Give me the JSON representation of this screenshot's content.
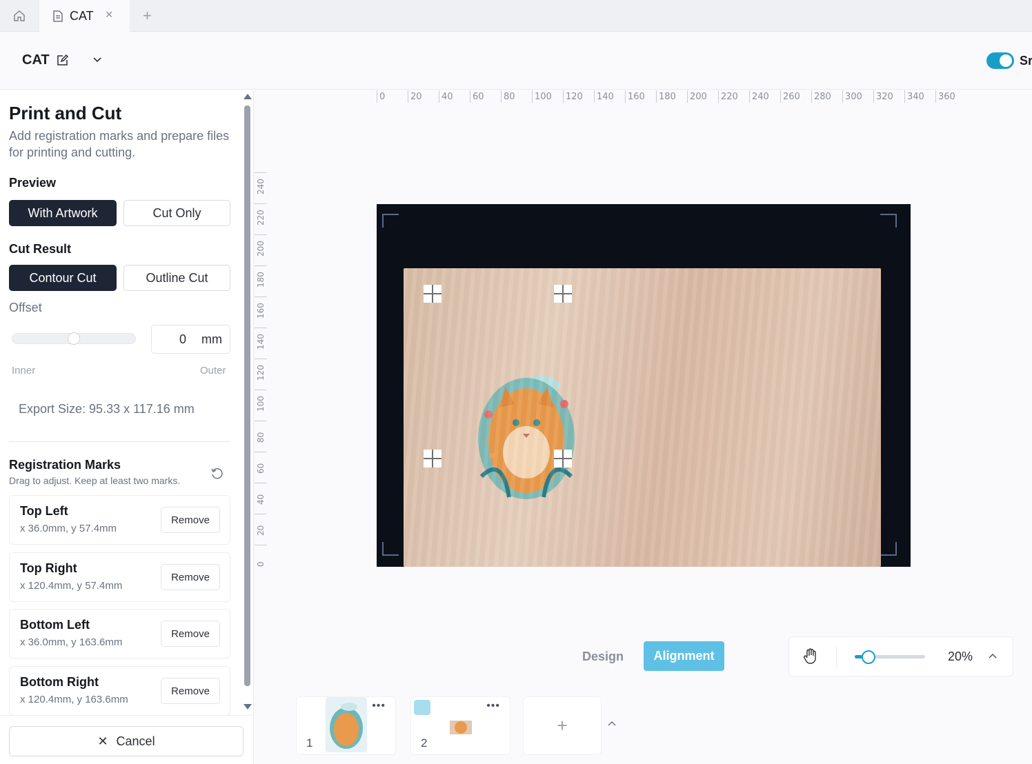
{
  "tabs": {
    "active_label": "CAT"
  },
  "header": {
    "project_name": "CAT",
    "toggle_label": "Sr"
  },
  "panel": {
    "title": "Print and Cut",
    "description": "Add registration marks and prepare files for printing and cutting.",
    "preview": {
      "label": "Preview",
      "options": [
        "With Artwork",
        "Cut Only"
      ],
      "selected": "With Artwork"
    },
    "cut_result": {
      "label": "Cut Result",
      "options": [
        "Contour Cut",
        "Outline Cut"
      ],
      "selected": "Contour Cut"
    },
    "offset": {
      "label": "Offset",
      "value": "0",
      "unit": "mm",
      "min_label": "Inner",
      "max_label": "Outer",
      "slider_fraction": 0.5
    },
    "export_size": "Export Size: 95.33 x 117.16 mm",
    "registration": {
      "title": "Registration Marks",
      "subtitle": "Drag to adjust. Keep at least two marks.",
      "remove_label": "Remove",
      "marks": [
        {
          "name": "Top Left",
          "coords": "x 36.0mm, y 57.4mm"
        },
        {
          "name": "Top Right",
          "coords": "x 120.4mm, y 57.4mm"
        },
        {
          "name": "Bottom Left",
          "coords": "x 36.0mm, y 163.6mm"
        },
        {
          "name": "Bottom Right",
          "coords": "x 120.4mm, y 163.6mm"
        }
      ]
    },
    "cancel_label": "Cancel"
  },
  "ruler": {
    "top": [
      "0",
      "20",
      "40",
      "60",
      "80",
      "100",
      "120",
      "140",
      "160",
      "180",
      "200",
      "220",
      "240",
      "260",
      "280",
      "300",
      "320",
      "340",
      "360"
    ],
    "left": [
      "240",
      "220",
      "200",
      "180",
      "160",
      "140",
      "120",
      "100",
      "80",
      "60",
      "40",
      "20",
      "0"
    ]
  },
  "modes": {
    "design": "Design",
    "alignment": "Alignment",
    "selected": "Alignment"
  },
  "zoom": {
    "value": "20%",
    "fraction": 0.2
  },
  "pages": [
    {
      "number": "1"
    },
    {
      "number": "2"
    }
  ],
  "colors": {
    "accent": "#1a9ec9",
    "active_segment": "#1e2535",
    "alignment_button": "#5ec0e4"
  }
}
